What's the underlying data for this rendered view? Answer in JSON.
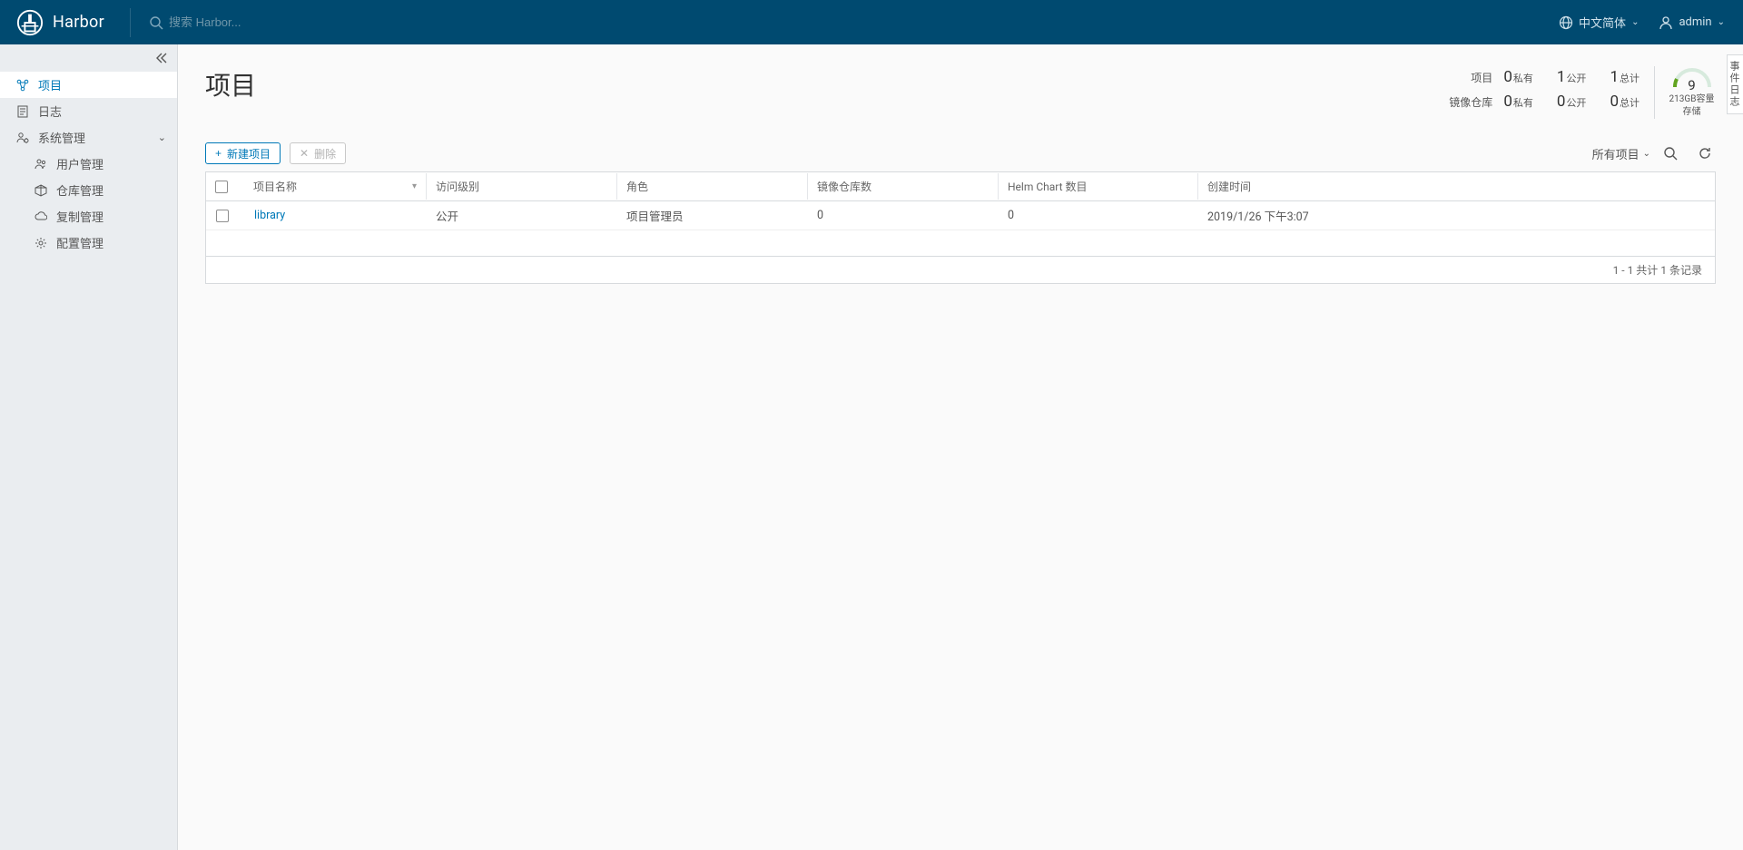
{
  "header": {
    "brand": "Harbor",
    "search_placeholder": "搜索 Harbor...",
    "lang_label": "中文简体",
    "user_label": "admin"
  },
  "sidebar": {
    "items": {
      "projects": "项目",
      "logs": "日志",
      "admin": "系统管理",
      "users": "用户管理",
      "repos": "仓库管理",
      "replication": "复制管理",
      "config": "配置管理"
    }
  },
  "page": {
    "title": "项目",
    "stats": {
      "row1_label": "项目",
      "row2_label": "镜像仓库",
      "private_label": "私有",
      "public_label": "公开",
      "total_label": "总计",
      "proj_private": "0",
      "proj_public": "1",
      "proj_total": "1",
      "repo_private": "0",
      "repo_public": "0",
      "repo_total": "0"
    },
    "storage": {
      "value": "9",
      "cap_label": "213GB容量",
      "storage_label": "存储"
    },
    "event_tab": "事件日志"
  },
  "actions": {
    "new_project": "新建项目",
    "delete": "删除",
    "filter_label": "所有项目"
  },
  "table": {
    "cols": {
      "name": "项目名称",
      "access": "访问级别",
      "role": "角色",
      "repo_count": "镜像仓库数",
      "chart_count": "Helm Chart 数目",
      "created": "创建时间"
    },
    "rows": [
      {
        "name": "library",
        "access": "公开",
        "role": "项目管理员",
        "repo_count": "0",
        "chart_count": "0",
        "created": "2019/1/26 下午3:07"
      }
    ],
    "footer": "1 - 1 共计 1 条记录"
  }
}
